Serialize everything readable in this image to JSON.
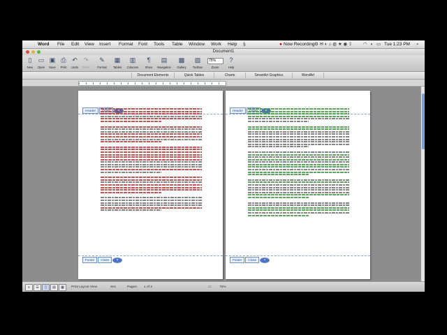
{
  "menubar": {
    "items": [
      "Word",
      "File",
      "Edit",
      "View",
      "Insert",
      "Format",
      "Font",
      "Tools",
      "Table",
      "Window",
      "Work",
      "Help"
    ],
    "recording": "Now Recording",
    "clock": "Tue 1:23 PM"
  },
  "window": {
    "title": "Document1"
  },
  "toolbar": {
    "buttons": [
      "New",
      "Open",
      "Save",
      "Print",
      "Undo",
      "Redo",
      "Format",
      "Tables",
      "Columns",
      "Show",
      "Navigation",
      "Gallery",
      "Toolbox",
      "Zoom",
      "Help"
    ],
    "zoom": "75%"
  },
  "ribbon": {
    "tabs": [
      "Document Elements",
      "Quick Tables",
      "Charts",
      "SmartArt Graphics",
      "WordArt"
    ]
  },
  "pages": [
    {
      "header_label": "Header",
      "header_close": "Close",
      "footer_label": "Footer",
      "footer_close": "Close",
      "markup_color": "#b33333"
    },
    {
      "header_label": "Header",
      "header_close": "Close",
      "footer_label": "Footer",
      "footer_close": "Close",
      "markup_color": "#3a9a3a"
    }
  ],
  "statusbar": {
    "view": "Print Layout View",
    "sec": "Sec",
    "pages_label": "Pages:",
    "pages_value": "1 of 2",
    "zoom": "75%"
  },
  "colors": {
    "accent": "#4a72c0",
    "header_border": "#6d8ec9"
  }
}
